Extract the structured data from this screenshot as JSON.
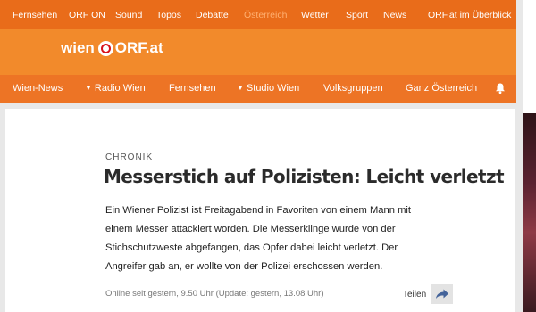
{
  "topnav": {
    "items": [
      "Fernsehen",
      "ORF ON",
      "Sound",
      "Topos",
      "Debatte",
      "Österreich",
      "Wetter",
      "Sport",
      "News"
    ],
    "overview": "ORF.at im Überblick",
    "active_index": 5
  },
  "logo": {
    "wien": "wien",
    "orf": "ORF.at"
  },
  "regional_nav": {
    "items": [
      {
        "label": "Wien-News",
        "has_dropdown": false
      },
      {
        "label": "Radio Wien",
        "has_dropdown": true
      },
      {
        "label": "Fernsehen",
        "has_dropdown": false
      },
      {
        "label": "Studio Wien",
        "has_dropdown": true
      },
      {
        "label": "Volksgruppen",
        "has_dropdown": false
      },
      {
        "label": "Ganz Österreich",
        "has_dropdown": false
      }
    ],
    "icon": "bell-icon"
  },
  "article": {
    "kicker": "CHRONIK",
    "headline": "Messerstich auf Polizisten: Leicht verletzt",
    "lead": "Ein Wiener Polizist ist Freitagabend in Favoriten von einem Mann mit einem Messer attackiert worden. Die Messerklinge wurde von der Stichschutzweste abgefangen, das Opfer dabei leicht verletzt. Der Angreifer gab an, er wollte von der Polizei erschossen werden.",
    "meta": "Online seit gestern, 9.50 Uhr (Update: gestern, 13.08 Uhr)",
    "share_label": "Teilen",
    "share_icon": "share-arrow-icon"
  },
  "colors": {
    "top_bar": "#e96c1a",
    "header": "#f28a2b",
    "nav_bar": "#ed7425",
    "active_link": "#ffb071",
    "logo_red": "#d8121b"
  }
}
